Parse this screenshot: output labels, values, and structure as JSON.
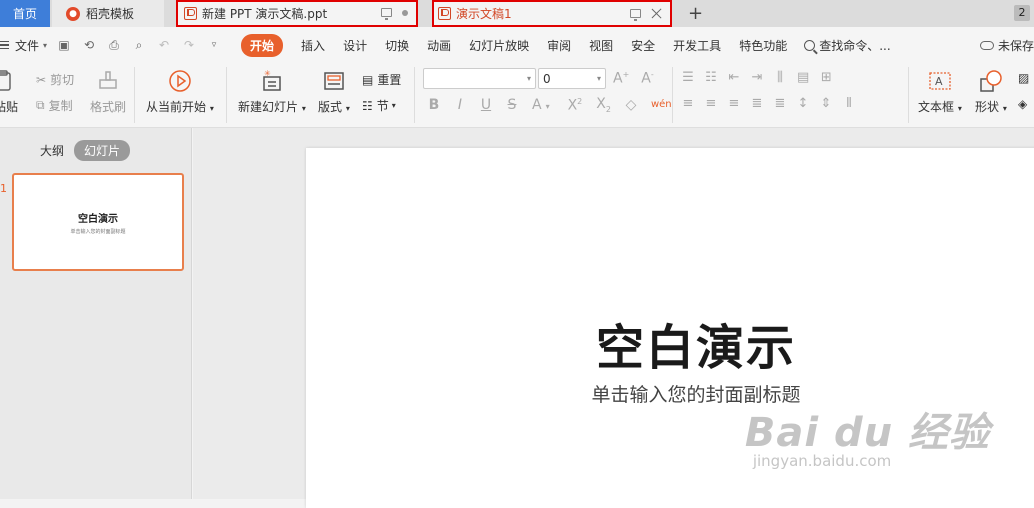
{
  "tabs": {
    "home": "首页",
    "docer": "稻壳模板",
    "doc1": "新建 PPT 演示文稿.ppt",
    "doc2": "演示文稿1",
    "window_count": "2"
  },
  "menu": {
    "file": "文件",
    "items": [
      "开始",
      "插入",
      "设计",
      "切换",
      "动画",
      "幻灯片放映",
      "审阅",
      "视图",
      "安全",
      "开发工具",
      "特色功能"
    ],
    "search": "查找命令、...",
    "unsaved": "未保存"
  },
  "ribbon": {
    "paste": "粘贴",
    "cut": "剪切",
    "copy": "复制",
    "format_painter": "格式刷",
    "play_from_current": "从当前开始",
    "new_slide": "新建幻灯片",
    "layout": "版式",
    "reset": "重置",
    "section": "节",
    "font_size": "0",
    "text_box": "文本框",
    "shape": "形状"
  },
  "left_panel": {
    "outline_tab": "大纲",
    "slides_tab": "幻灯片",
    "slide_number": "1",
    "thumb_title": "空白演示",
    "thumb_subtitle": "单击输入您的封面副标题"
  },
  "slide": {
    "title": "空白演示",
    "subtitle": "单击输入您的封面副标题"
  },
  "watermark": {
    "main": "Bai du 经验",
    "sub": "jingyan.baidu.com"
  },
  "colors": {
    "accent": "#e8602c",
    "home_tab": "#3e7ed9",
    "highlight_border": "#e00000"
  }
}
